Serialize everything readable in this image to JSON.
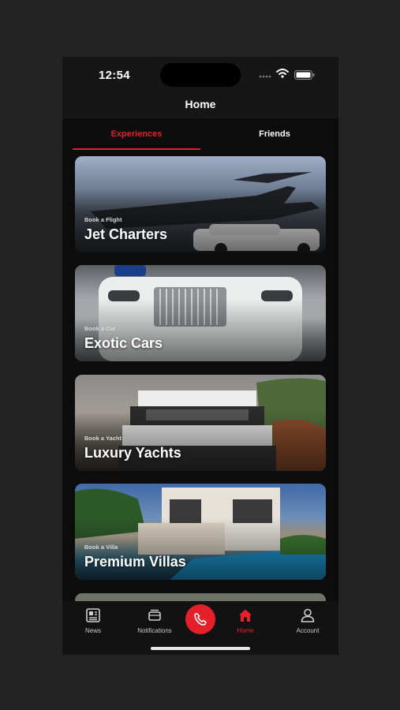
{
  "status_bar": {
    "time": "12:54"
  },
  "header": {
    "title": "Home"
  },
  "tabs": [
    {
      "label": "Experiences",
      "active": true
    },
    {
      "label": "Friends",
      "active": false
    }
  ],
  "cards": [
    {
      "subtitle": "Book a Flight",
      "title": "Jet Charters"
    },
    {
      "subtitle": "Book a Car",
      "title": "Exotic Cars"
    },
    {
      "subtitle": "Book a Yacht",
      "title": "Luxury Yachts"
    },
    {
      "subtitle": "Book a Villa",
      "title": "Premium Villas"
    }
  ],
  "tabbar": {
    "items": [
      {
        "label": "News",
        "icon": "newspaper-icon"
      },
      {
        "label": "Notifications",
        "icon": "tray-icon"
      },
      {
        "label": "Home",
        "icon": "home-icon",
        "active": true
      },
      {
        "label": "Account",
        "icon": "user-icon"
      }
    ],
    "call_icon": "phone-icon"
  },
  "colors": {
    "accent": "#e5202a",
    "background": "#0c0c0c",
    "outer_background": "#232323"
  }
}
